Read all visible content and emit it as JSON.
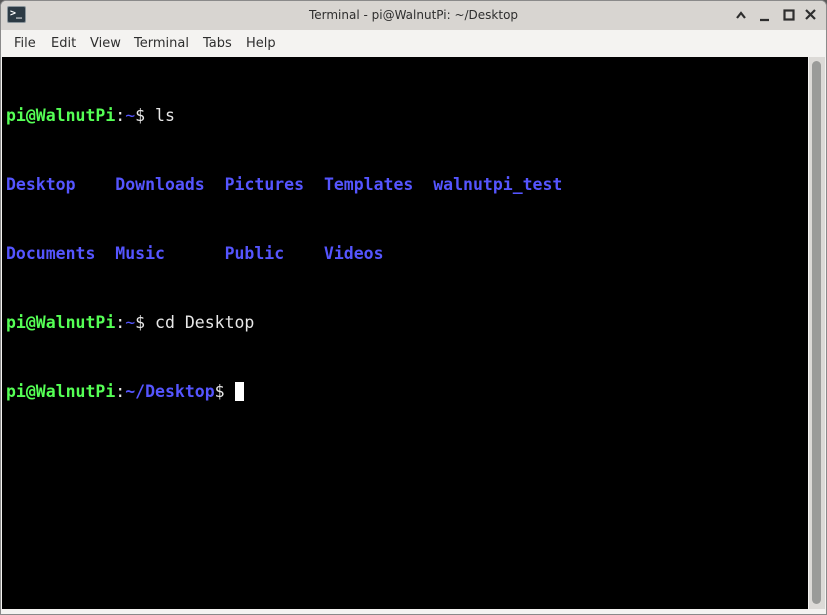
{
  "window": {
    "title": "Terminal - pi@WalnutPi: ~/Desktop",
    "icon": "terminal-icon",
    "controls": {
      "shade": "^",
      "minimize": "_",
      "maximize": "☐",
      "close": "✕"
    }
  },
  "menubar": {
    "items": [
      "File",
      "Edit",
      "View",
      "Terminal",
      "Tabs",
      "Help"
    ]
  },
  "terminal": {
    "colors": {
      "prompt_user": "#55ff55",
      "path": "#5555ff",
      "directory": "#5555ff",
      "text": "#e8e8e8",
      "background": "#000000"
    },
    "lines": [
      {
        "user": "pi@WalnutPi",
        "sep": ":",
        "path": "~",
        "sym": "$ ",
        "cmd": "ls"
      },
      {
        "dirs": [
          "Desktop",
          "Downloads",
          "Pictures",
          "Templates",
          "walnutpi_test"
        ]
      },
      {
        "dirs": [
          "Documents",
          "Music",
          "Public",
          "Videos"
        ]
      },
      {
        "user": "pi@WalnutPi",
        "sep": ":",
        "path": "~",
        "sym": "$ ",
        "cmd": "cd Desktop"
      },
      {
        "user": "pi@WalnutPi",
        "sep": ":",
        "path": "~/Desktop",
        "sym": "$ ",
        "cmd": ""
      }
    ]
  }
}
